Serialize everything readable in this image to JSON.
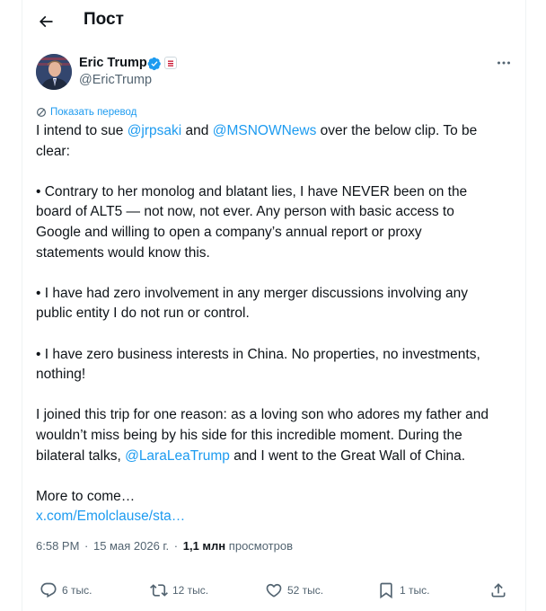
{
  "header": {
    "title": "Пост"
  },
  "author": {
    "name": "Eric Trump",
    "handle": "@EricTrump"
  },
  "translate_label": "Показать перевод",
  "tweet": {
    "lines": [
      [
        {
          "t": "I intend to sue "
        },
        {
          "t": "@jrpsaki",
          "m": 1
        },
        {
          "t": " and "
        },
        {
          "t": "@MSNOWNews",
          "m": 1
        },
        {
          "t": " over the below clip. To be"
        }
      ],
      [
        {
          "t": "clear:"
        }
      ],
      [],
      [
        {
          "t": "• Contrary to her monolog and blatant lies, I have NEVER been on the"
        }
      ],
      [
        {
          "t": "board of ALT5 — not now, not ever. Any person with basic access to"
        }
      ],
      [
        {
          "t": "Google and willing to open a company’s annual report or proxy"
        }
      ],
      [
        {
          "t": "statements would know this."
        }
      ],
      [],
      [
        {
          "t": "• I have had zero involvement in any merger discussions involving any"
        }
      ],
      [
        {
          "t": "public entity I do not run or control."
        }
      ],
      [],
      [
        {
          "t": "• I have zero business interests in China. No properties, no investments,"
        }
      ],
      [
        {
          "t": "nothing!"
        }
      ],
      [],
      [
        {
          "t": "I joined this trip for one reason: as a loving son who adores my father and"
        }
      ],
      [
        {
          "t": "wouldn’t miss being by his side for this incredible moment. During the"
        }
      ],
      [
        {
          "t": "bilateral talks, "
        },
        {
          "t": "@LaraLeaTrump",
          "m": 1
        },
        {
          "t": " and I went to the Great Wall of China."
        }
      ],
      [],
      [
        {
          "t": "More to come…"
        }
      ]
    ],
    "link": "x.com/Emolclause/sta…"
  },
  "meta": {
    "time": "6:58 PM",
    "date": "15 мая 2026 г.",
    "views": "1,1 млн",
    "views_label": "просмотров"
  },
  "actions": {
    "replies": "6 тыс.",
    "reposts": "12 тыс.",
    "likes": "52 тыс.",
    "bookmarks": "1 тыс."
  },
  "colors": {
    "accent": "#1d9bf0",
    "text": "#0f1419",
    "muted": "#536471"
  },
  "icons": [
    "back-arrow-icon",
    "verified-badge-icon",
    "affiliate-badge-icon",
    "more-icon",
    "translate-icon",
    "reply-icon",
    "repost-icon",
    "like-icon",
    "bookmark-icon",
    "share-icon"
  ]
}
